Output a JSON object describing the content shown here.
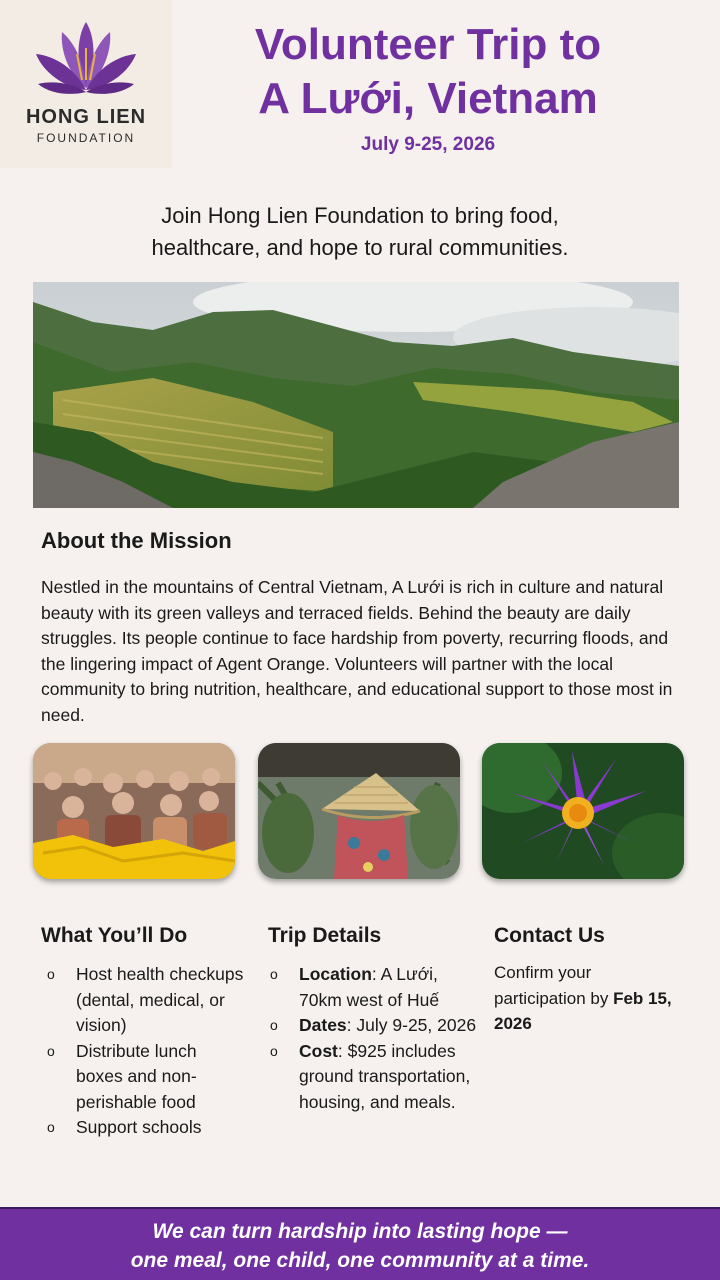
{
  "logo": {
    "name": "HONG LIEN",
    "subtitle": "FOUNDATION",
    "icon": "lotus-icon",
    "color": "#7030a0"
  },
  "header": {
    "title_line1": "Volunteer Trip to",
    "title_line2": "A Lưới, Vietnam",
    "dates": "July 9-25, 2026",
    "accent_color": "#7030a0"
  },
  "intro": {
    "line1": "Join Hong Lien Foundation to bring food,",
    "line2": "healthcare, and hope to rural communities."
  },
  "hero_image": "mountain-valley-terraced-fields-photo",
  "about": {
    "heading": "About the Mission",
    "body": "Nestled in the mountains of Central Vietnam, A Lưới is rich in culture and natural beauty with its green valleys and terraced fields. Behind the beauty are daily struggles. Its people continue to face hardship from poverty, recurring floods, and the lingering impact of Agent Orange. Volunteers will partner with the local community to bring nutrition, healthcare, and educational support to those most in need."
  },
  "photos": [
    "elderly-group-with-yellow-bags-photo",
    "conical-hat-photo",
    "purple-water-lily-photo"
  ],
  "what_you_do": {
    "heading": "What You’ll Do",
    "bullet": "o",
    "items": [
      "Host health checkups (dental, medical, or vision)",
      "Distribute lunch boxes and non-perishable food",
      "Support schools"
    ]
  },
  "trip_details": {
    "heading": "Trip Details",
    "bullet": "o",
    "items": [
      {
        "label": "Location",
        "value": ":  A Lưới, 70km west of Huế"
      },
      {
        "label": "Dates",
        "value": ":  July 9-25, 2026"
      },
      {
        "label": "Cost",
        "value": ":  $925 includes ground transportation, housing, and meals."
      }
    ]
  },
  "contact": {
    "heading": "Contact Us",
    "text": "Confirm your participation by ",
    "deadline": "Feb 15, 2026"
  },
  "footer": {
    "line1": "We can turn hardship into lasting hope —",
    "line2": "one meal, one child, one community at a time.",
    "background": "#7030a0"
  }
}
